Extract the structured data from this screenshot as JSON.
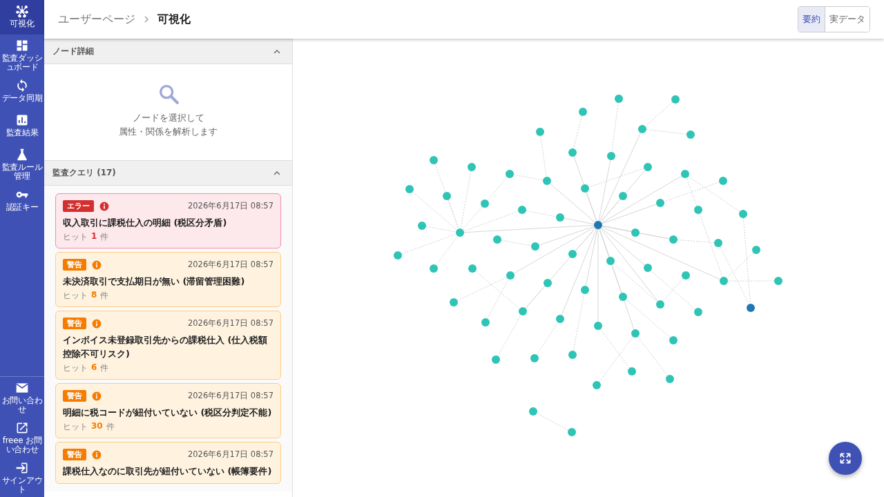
{
  "sidebar": {
    "items": [
      {
        "label": "可視化",
        "selected": true
      },
      {
        "label": "監査ダッシュボード",
        "selected": false
      },
      {
        "label": "データ同期",
        "selected": false
      },
      {
        "label": "監査結果",
        "selected": false
      },
      {
        "label": "監査ルール管理",
        "selected": false
      },
      {
        "label": "認証キー",
        "selected": false
      }
    ],
    "footer_items": [
      {
        "label": "お問い合わせ"
      },
      {
        "label": "freee お問い合わせ"
      },
      {
        "label": "サインアウト"
      }
    ]
  },
  "header": {
    "breadcrumbs": [
      "ユーザーページ",
      "可視化"
    ],
    "view_toggle": [
      {
        "label": "要約",
        "selected": true
      },
      {
        "label": "実データ",
        "selected": false
      }
    ]
  },
  "node_detail": {
    "title": "ノード詳細",
    "expanded": true,
    "hint_lines": [
      "ノードを選択して",
      "属性・関係を解析します"
    ]
  },
  "queries": {
    "title": "監査クエリ (17)",
    "expanded": true,
    "items": [
      {
        "kind": "error",
        "badge": "エラー",
        "date": "2026年6月17日 08:57",
        "title": "収入取引に課税仕入の明細 (税区分矛盾)",
        "hit_label": "ヒット",
        "hits": "1",
        "hit_unit": "件"
      },
      {
        "kind": "warning",
        "badge": "警告",
        "date": "2026年6月17日 08:57",
        "title": "未決済取引で支払期日が無い (滞留管理困難)",
        "hit_label": "ヒット",
        "hits": "8",
        "hit_unit": "件"
      },
      {
        "kind": "warning",
        "badge": "警告",
        "date": "2026年6月17日 08:57",
        "title": "インボイス未登録取引先からの課税仕入 (仕入税額控除不可リスク)",
        "hit_label": "ヒット",
        "hits": "6",
        "hit_unit": "件"
      },
      {
        "kind": "warning",
        "badge": "警告",
        "date": "2026年6月17日 08:57",
        "title": "明細に税コードが紐付いていない (税区分判定不能)",
        "hit_label": "ヒット",
        "hits": "30",
        "hit_unit": "件"
      },
      {
        "kind": "warning",
        "badge": "警告",
        "date": "2026年6月17日 08:57",
        "title": "課税仕入なのに取引先が紐付いていない (帳簿要件)"
      }
    ]
  },
  "graph": {
    "nodes": [
      {
        "color": "#2ec4b6"
      },
      {
        "color": "#2ec4b6"
      },
      {
        "color": "#2ec4b6"
      },
      {
        "color": "#2ec4b6"
      },
      {
        "color": "#2ec4b6"
      },
      {
        "color": "#2ec4b6"
      },
      {
        "color": "#2ec4b6"
      },
      {
        "color": "#2ec4b6"
      },
      {
        "color": "#2ec4b6"
      },
      {
        "color": "#2ec4b6"
      },
      {
        "color": "#2ec4b6"
      },
      {
        "color": "#2ec4b6"
      },
      {
        "color": "#2ec4b6"
      },
      {
        "color": "#2ec4b6"
      },
      {
        "color": "#2ec4b6"
      },
      {
        "color": "#2ec4b6"
      },
      {
        "color": "#2ec4b6"
      },
      {
        "color": "#2ec4b6"
      },
      {
        "color": "#2ec4b6"
      },
      {
        "color": "#2ec4b6"
      },
      {
        "color": "#2ec4b6"
      },
      {
        "color": "#2ec4b6"
      },
      {
        "color": "#2ec4b6"
      },
      {
        "color": "#2ec4b6"
      },
      {
        "color": "#2ec4b6"
      },
      {
        "color": "#1f77b4"
      },
      {
        "color": "#2ec4b6"
      },
      {
        "color": "#2ec4b6"
      },
      {
        "color": "#2ec4b6"
      },
      {
        "color": "#2ec4b6"
      },
      {
        "color": "#2ec4b6"
      },
      {
        "color": "#2ec4b6"
      },
      {
        "color": "#2ec4b6"
      },
      {
        "color": "#2ec4b6"
      },
      {
        "color": "#2ec4b6"
      },
      {
        "color": "#2ec4b6"
      },
      {
        "color": "#2ec4b6"
      },
      {
        "color": "#2ec4b6"
      },
      {
        "color": "#2ec4b6"
      },
      {
        "color": "#2ec4b6"
      },
      {
        "color": "#2ec4b6"
      },
      {
        "color": "#2ec4b6"
      },
      {
        "color": "#2ec4b6"
      },
      {
        "color": "#2ec4b6"
      },
      {
        "color": "#2ec4b6"
      },
      {
        "color": "#2ec4b6"
      },
      {
        "color": "#2ec4b6"
      },
      {
        "color": "#2ec4b6"
      },
      {
        "color": "#2ec4b6"
      },
      {
        "color": "#1f77b4"
      },
      {
        "color": "#2ec4b6"
      },
      {
        "color": "#2ec4b6"
      },
      {
        "color": "#2ec4b6"
      },
      {
        "color": "#2ec4b6"
      },
      {
        "color": "#2ec4b6"
      },
      {
        "color": "#2ec4b6"
      },
      {
        "color": "#2ec4b6"
      },
      {
        "color": "#2ec4b6"
      },
      {
        "color": "#2ec4b6"
      },
      {
        "color": "#2ec4b6"
      },
      {
        "color": "#2ec4b6"
      },
      {
        "color": "#2ec4b6"
      },
      {
        "color": "#2ec4b6"
      },
      {
        "color": "#2ec4b6"
      },
      {
        "color": "#2ec4b6"
      }
    ]
  }
}
